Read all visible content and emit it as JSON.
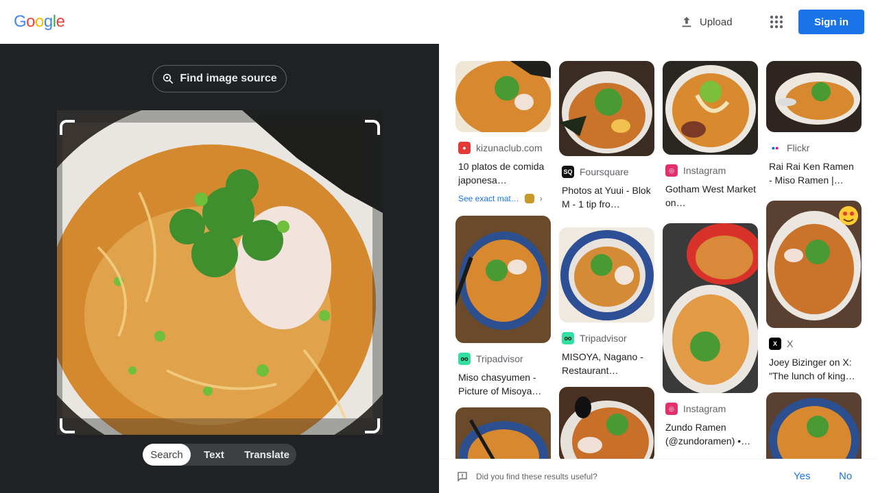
{
  "header": {
    "logo_letters": [
      "G",
      "o",
      "o",
      "g",
      "l",
      "e"
    ],
    "upload_label": "Upload",
    "apps_icon": "apps-grid-icon",
    "signin_label": "Sign in"
  },
  "lens": {
    "find_source_label": "Find image source",
    "modes": [
      {
        "label": "Search",
        "active": true
      },
      {
        "label": "Text",
        "active": false
      },
      {
        "label": "Translate",
        "active": false
      }
    ]
  },
  "results": {
    "col1": [
      {
        "source": "kizunaclub.com",
        "title": "10 platos de comida japonesa…",
        "exact_match": "See exact mat…",
        "favicon_color": "#e53935"
      },
      {
        "source": "Tripadvisor",
        "title": "Miso chasyumen - Picture of Misoya…",
        "favicon_color": "#34e0a1"
      },
      {
        "source": "",
        "title": ""
      }
    ],
    "col2": [
      {
        "source": "Foursquare",
        "title": "Photos at Yuui - Blok M - 1 tip fro…",
        "favicon_color": "#111111"
      },
      {
        "source": "Tripadvisor",
        "title": "MISOYA, Nagano - Restaurant…",
        "favicon_color": "#34e0a1"
      },
      {
        "source": "",
        "title": ""
      }
    ],
    "col3": [
      {
        "source": "Instagram",
        "title": "Gotham West Market on…",
        "favicon_color": "#e1306c"
      },
      {
        "source": "Instagram",
        "title": "Zundo Ramen (@zundoramen) •…",
        "favicon_color": "#e1306c"
      }
    ],
    "col4": [
      {
        "source": "Flickr",
        "title": "Rai Rai Ken Ramen - Miso Ramen |…",
        "favicon_color": "#0063dc"
      },
      {
        "source": "X",
        "title": "Joey Bizinger on X: \"The lunch of king…",
        "favicon_color": "#000000"
      },
      {
        "source": "",
        "title": ""
      }
    ]
  },
  "feedback": {
    "question": "Did you find these results useful?",
    "yes": "Yes",
    "no": "No"
  }
}
